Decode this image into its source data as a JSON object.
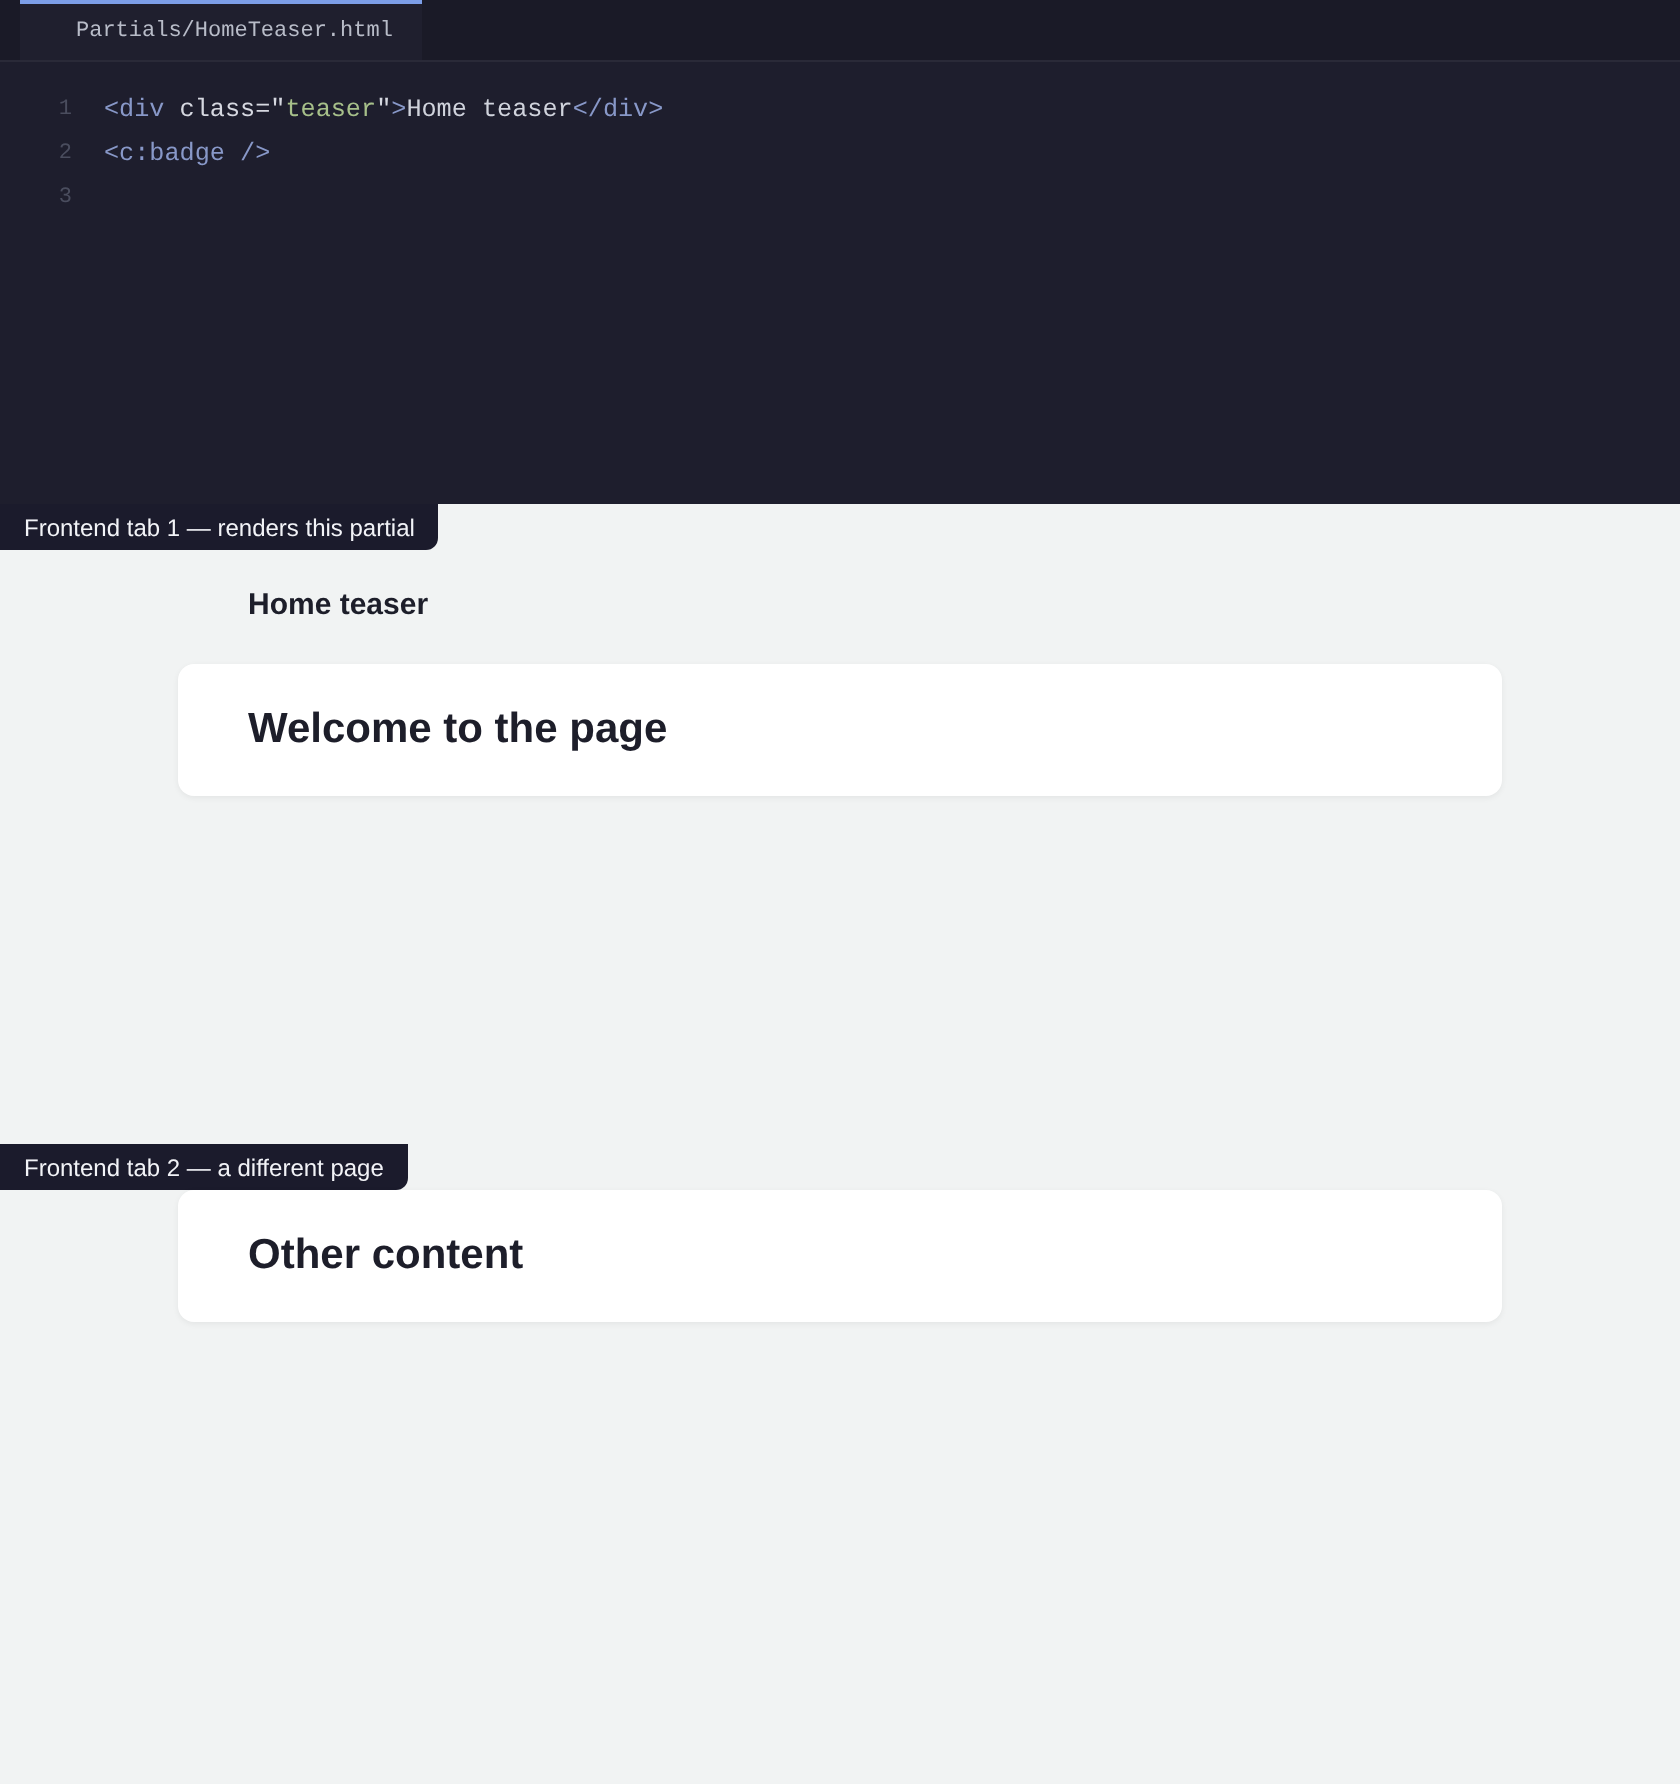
{
  "editor": {
    "tabs": [
      {
        "label": "Partials/HomeTeaser.html",
        "selected": true
      }
    ],
    "lines": [
      {
        "number": "1",
        "tokens": [
          {
            "kind": "tag",
            "text": "<div "
          },
          {
            "kind": "attr",
            "text": "class=\""
          },
          {
            "kind": "string",
            "text": "teaser"
          },
          {
            "kind": "attr",
            "text": "\""
          },
          {
            "kind": "tag",
            "text": ">"
          },
          {
            "kind": "text",
            "text": "Home teaser"
          },
          {
            "kind": "tag",
            "text": "</div>"
          }
        ]
      },
      {
        "number": "2",
        "tokens": [
          {
            "kind": "tag",
            "text": "<c:badge />"
          }
        ]
      },
      {
        "number": "3"
      }
    ]
  },
  "frontends": [
    {
      "label": "Frontend tab 1 — renders this partial",
      "teaser": "Home teaser",
      "card": "Welcome to the page"
    },
    {
      "label": "Frontend tab 2 — a different page",
      "card": "Other content"
    }
  ]
}
